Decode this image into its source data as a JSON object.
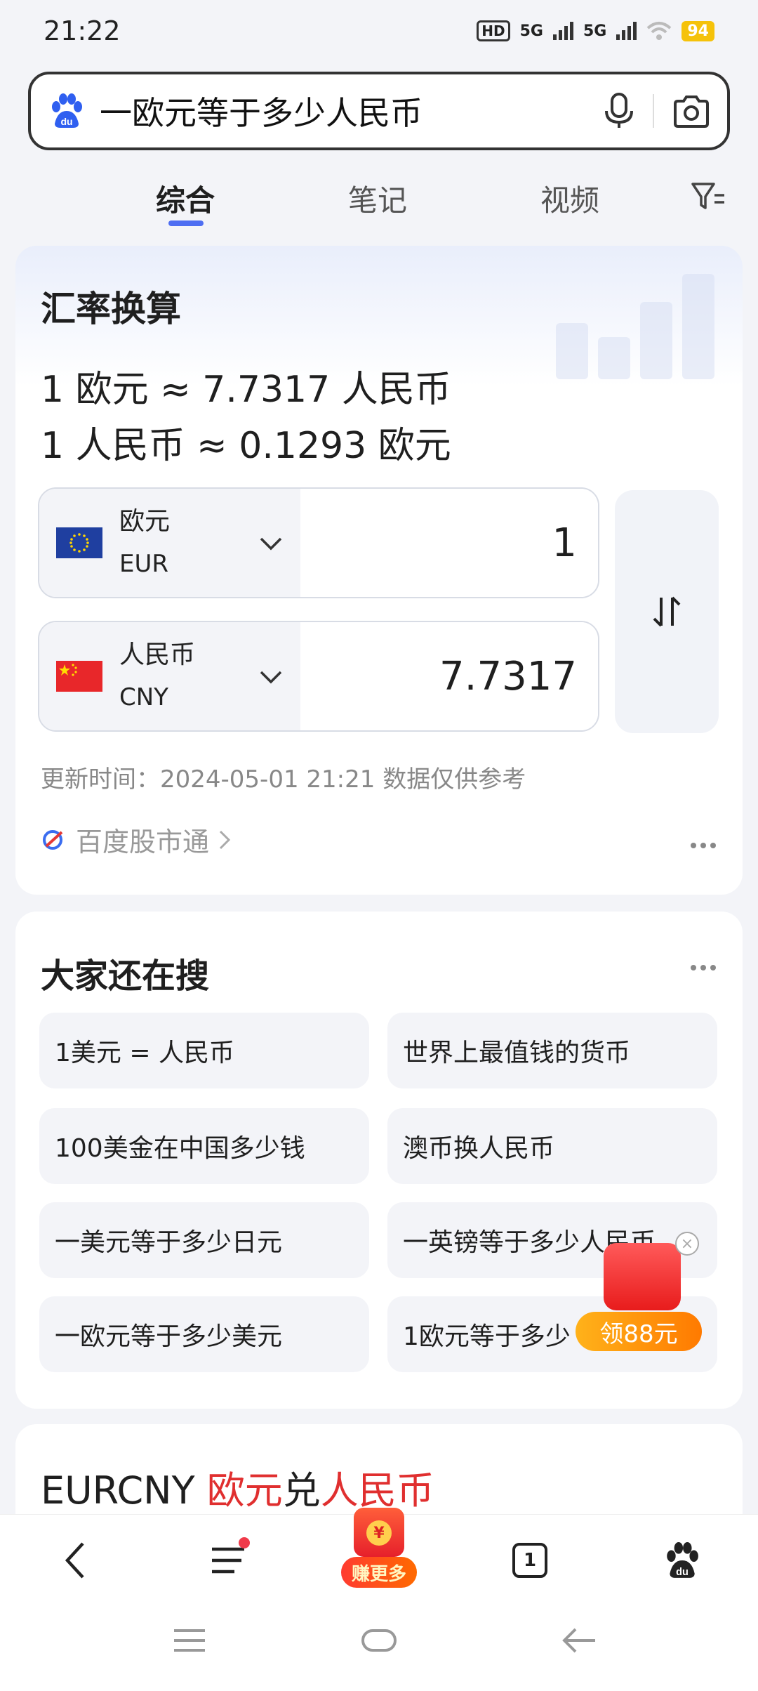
{
  "status": {
    "time": "21:22",
    "hd": "HD",
    "net1": "5G",
    "net2": "5G",
    "battery": "94"
  },
  "search": {
    "query": "一欧元等于多少人民币"
  },
  "tabs": [
    "综合",
    "笔记",
    "视频"
  ],
  "converter": {
    "title": "汇率换算",
    "rate_line_1": "1 欧元 ≈ 7.7317 人民币",
    "rate_line_2": "1 人民币 ≈ 0.1293 欧元",
    "from": {
      "name": "欧元",
      "code": "EUR",
      "value": "1"
    },
    "to": {
      "name": "人民币",
      "code": "CNY",
      "value": "7.7317"
    },
    "update_text": "更新时间：2024-05-01 21:21 数据仅供参考",
    "source": "百度股市通"
  },
  "related": {
    "title": "大家还在搜",
    "items": [
      "1美元 = 人民币",
      "世界上最值钱的货币",
      "100美金在中国多少钱",
      "澳币换人民币",
      "一美元等于多少日元",
      "一英镑等于多少人民币",
      "一欧元等于多少美元",
      "1欧元等于多少"
    ]
  },
  "promo": {
    "label": "领88元",
    "close": "×"
  },
  "next_card": {
    "prefix": "EURCNY ",
    "part1": "欧元",
    "mid": "兑",
    "part2": "人民币"
  },
  "bottom_nav": {
    "earn_label": "赚更多",
    "earn_coin": "¥",
    "tab_count": "1"
  },
  "colors": {
    "accent": "#4e6ef2",
    "highlight_red": "#e02f2f",
    "promo_orange": "#ff8a00"
  }
}
